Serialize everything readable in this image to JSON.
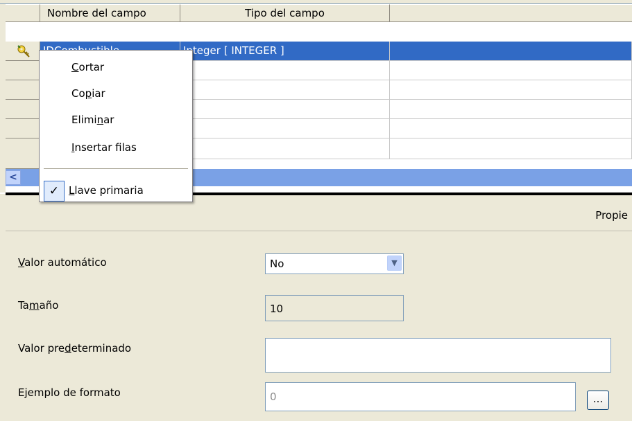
{
  "table": {
    "columns": [
      "Nombre del campo",
      "Tipo del campo",
      ""
    ],
    "rows": [
      {
        "name": "IDCombustible",
        "type": "Integer [ INTEGER ]"
      },
      {
        "name": "",
        "type": ""
      },
      {
        "name": "",
        "type": ""
      },
      {
        "name": "",
        "type": ""
      },
      {
        "name": "",
        "type": ""
      }
    ]
  },
  "context_menu": {
    "items": [
      {
        "pre": "",
        "u": "C",
        "post": "ortar"
      },
      {
        "pre": "Co",
        "u": "p",
        "post": "iar"
      },
      {
        "pre": "Elimi",
        "u": "n",
        "post": "ar"
      },
      {
        "pre": "",
        "u": "I",
        "post": "nsertar filas"
      }
    ],
    "check_item": {
      "pre": "",
      "u": "L",
      "post": "lave primaria",
      "checked": true
    },
    "check_glyph": "✓"
  },
  "properties": {
    "title": "Propie",
    "auto_value": {
      "label_u": "V",
      "label_post": "alor automático",
      "value": "No"
    },
    "size": {
      "label_pre": "Ta",
      "label_u": "m",
      "label_post": "año",
      "value": "10"
    },
    "default_value": {
      "label_pre": "Valor pre",
      "label_u": "d",
      "label_post": "eterminado",
      "value": ""
    },
    "format_example": {
      "label": "Ejemplo de formato",
      "value": "0",
      "button_label": "..."
    }
  },
  "icons": {
    "primary_key": "key-icon",
    "scroll_left": "chevron-left-icon",
    "dropdown": "chevron-down-icon"
  },
  "colors": {
    "selection": "#316ac5",
    "background": "#ece9d8"
  }
}
